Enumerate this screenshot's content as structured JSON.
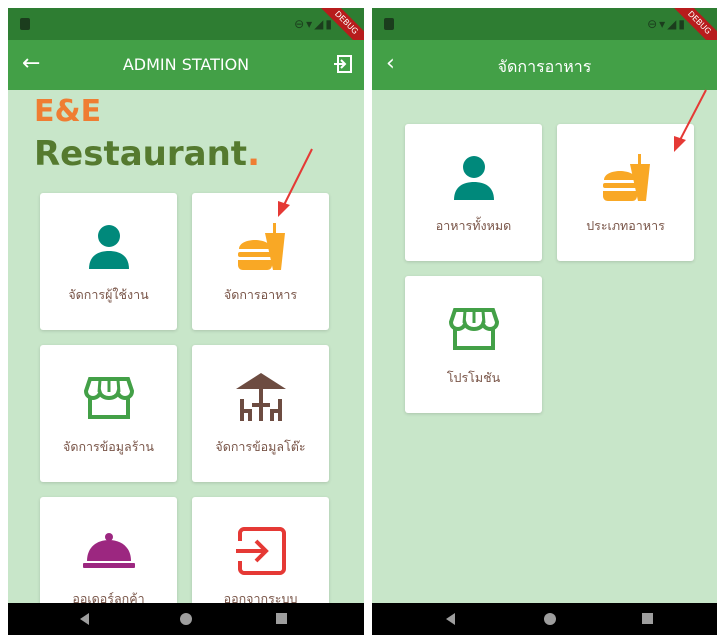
{
  "screen1": {
    "appbar": {
      "title": "ADMIN STATION"
    },
    "brand": {
      "line1": "E&E",
      "line2": "Restaurant",
      "dot": "."
    },
    "cards": [
      {
        "label": "จัดการผู้ใช้งาน",
        "icon": "person-icon"
      },
      {
        "label": "จัดการอาหาร",
        "icon": "fastfood-icon"
      },
      {
        "label": "จัดการข้อมูลร้าน",
        "icon": "storefront-icon"
      },
      {
        "label": "จัดการข้อมูลโต๊ะ",
        "icon": "table-umbrella-icon"
      },
      {
        "label": "ออเดอร์ลูกค้า",
        "icon": "room-service-icon"
      },
      {
        "label": "ออกจากระบบ",
        "icon": "exit-icon"
      }
    ]
  },
  "screen2": {
    "appbar": {
      "title": "จัดการอาหาร"
    },
    "cards": [
      {
        "label": "อาหารทั้งหมด",
        "icon": "person-icon"
      },
      {
        "label": "ประเภทอาหาร",
        "icon": "fastfood-icon"
      },
      {
        "label": "โปรโมชัน",
        "icon": "storefront-icon"
      }
    ]
  },
  "status": {
    "debug_label": "DEBUG"
  },
  "colors": {
    "statusbar": "#2e7d32",
    "appbar": "#43a047",
    "background": "#c8e6c9",
    "brand_orange": "#ef7d32",
    "brand_green": "#557a2f",
    "label": "#795548",
    "teal_icon": "#00897b",
    "orange_icon": "#f9a825",
    "green_icon": "#43a047",
    "brown_icon": "#6d4c41",
    "purple_icon": "#9c2780",
    "red_icon": "#e53935",
    "arrow": "#e53935"
  }
}
